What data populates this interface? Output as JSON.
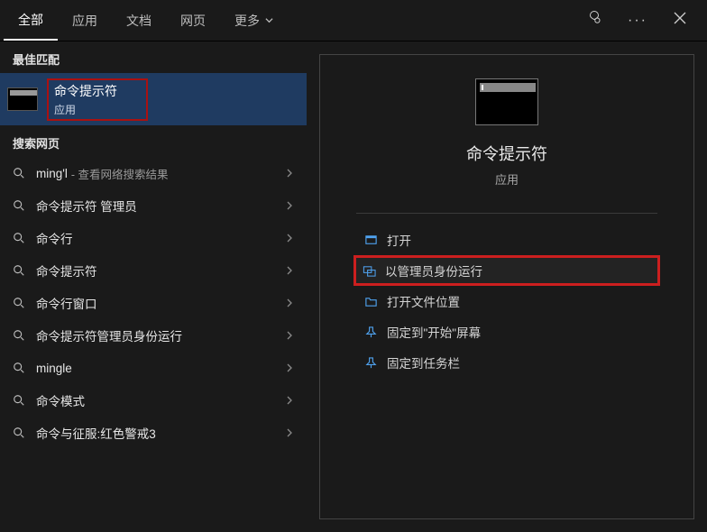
{
  "tabs": {
    "all": "全部",
    "apps": "应用",
    "docs": "文档",
    "web": "网页",
    "more": "更多"
  },
  "sections": {
    "best_match": "最佳匹配",
    "search_web": "搜索网页"
  },
  "best_match": {
    "title": "命令提示符",
    "subtitle": "应用"
  },
  "web_results": [
    {
      "main": "ming'l",
      "sub": "- 查看网络搜索结果"
    },
    {
      "main": "命令提示符 管理员"
    },
    {
      "main": "命令行"
    },
    {
      "main": "命令提示符"
    },
    {
      "main": "命令行窗口"
    },
    {
      "main": "命令提示符管理员身份运行"
    },
    {
      "main": "mingle"
    },
    {
      "main": "命令模式"
    },
    {
      "main": "命令与征服:红色警戒3"
    }
  ],
  "preview": {
    "title": "命令提示符",
    "subtitle": "应用"
  },
  "actions": {
    "open": "打开",
    "run_admin": "以管理员身份运行",
    "open_location": "打开文件位置",
    "pin_start": "固定到\"开始\"屏幕",
    "pin_taskbar": "固定到任务栏"
  }
}
